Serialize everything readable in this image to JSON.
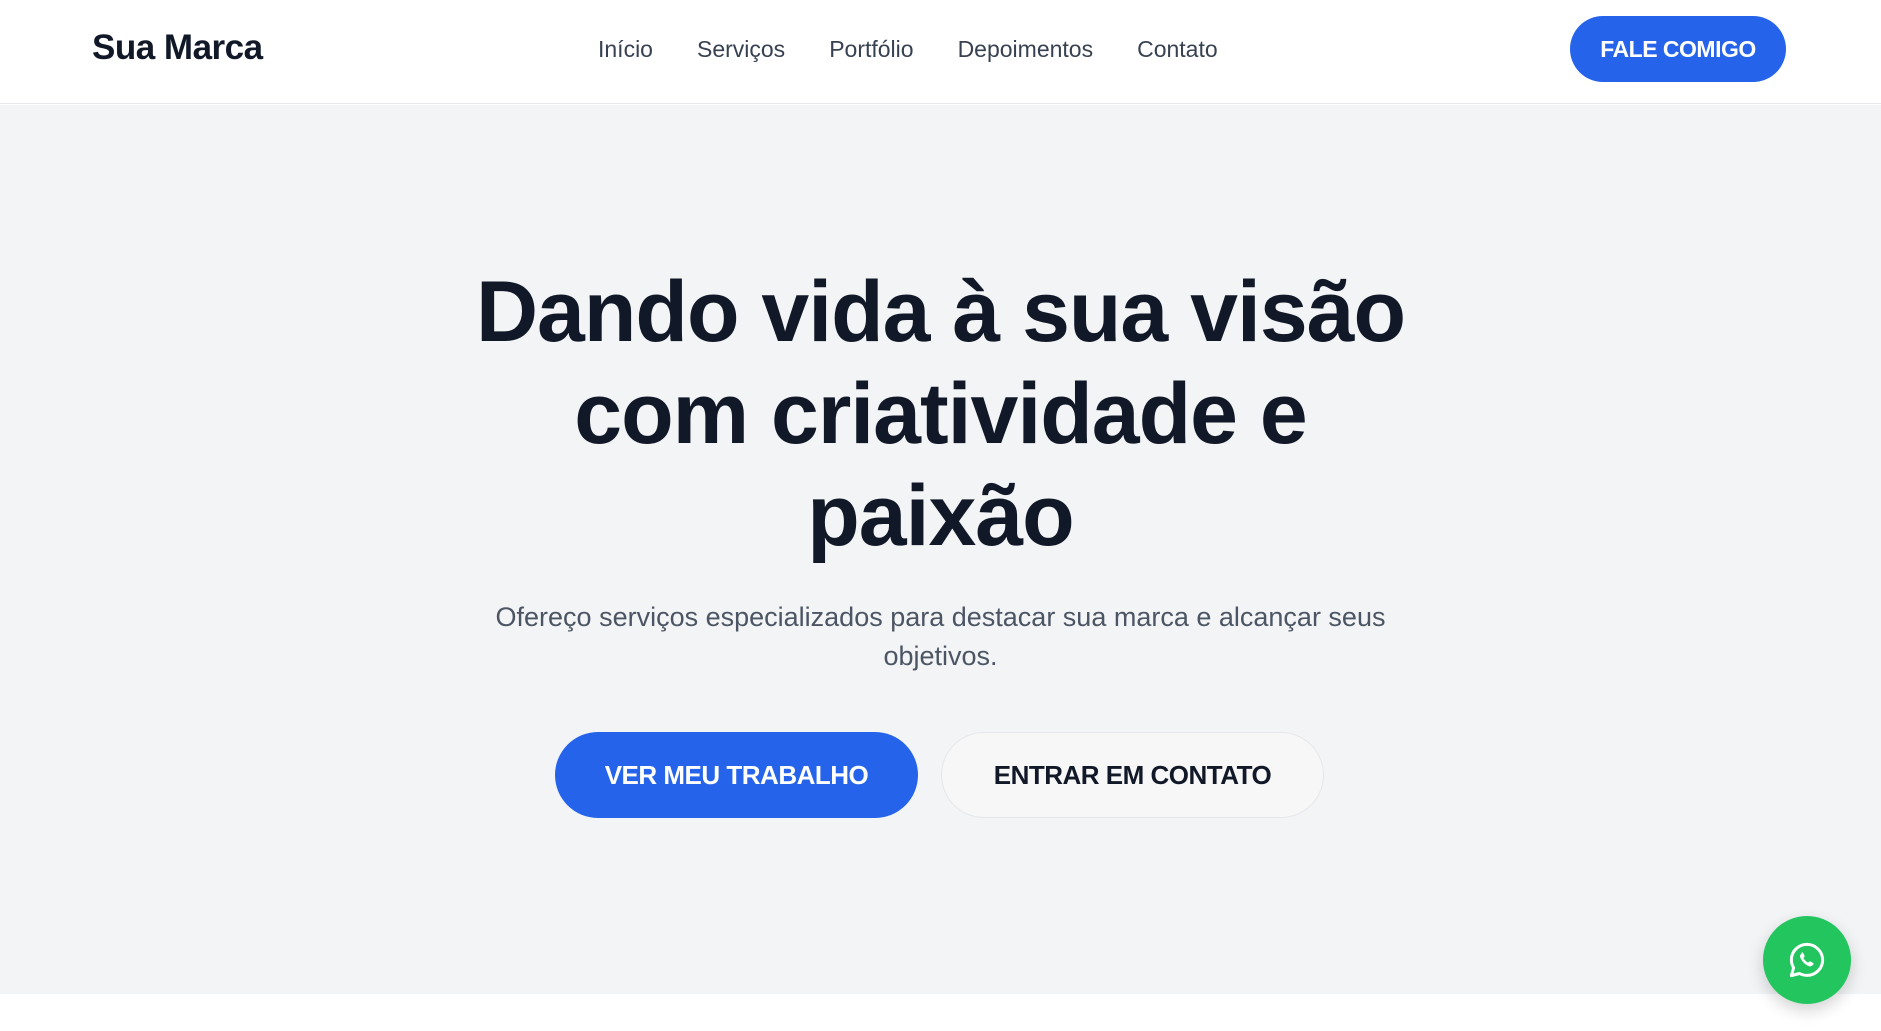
{
  "header": {
    "logo": "Sua Marca",
    "nav": [
      "Início",
      "Serviços",
      "Portfólio",
      "Depoimentos",
      "Contato"
    ],
    "cta": "FALE COMIGO"
  },
  "hero": {
    "title_lines": [
      "Dando vida à sua visão",
      "com criatividade e",
      "paixão"
    ],
    "subtitle_lines": [
      "Ofereço serviços especializados para destacar sua marca e alcançar seus",
      "objetivos."
    ],
    "primary_button": "VER MEU TRABALHO",
    "secondary_button": "ENTRAR EM CONTATO"
  },
  "floating": {
    "icon": "whatsapp-icon"
  },
  "colors": {
    "accent": "#2563eb",
    "hero_bg": "#f3f4f6",
    "heading": "#111827",
    "whatsapp": "#22c55e"
  }
}
